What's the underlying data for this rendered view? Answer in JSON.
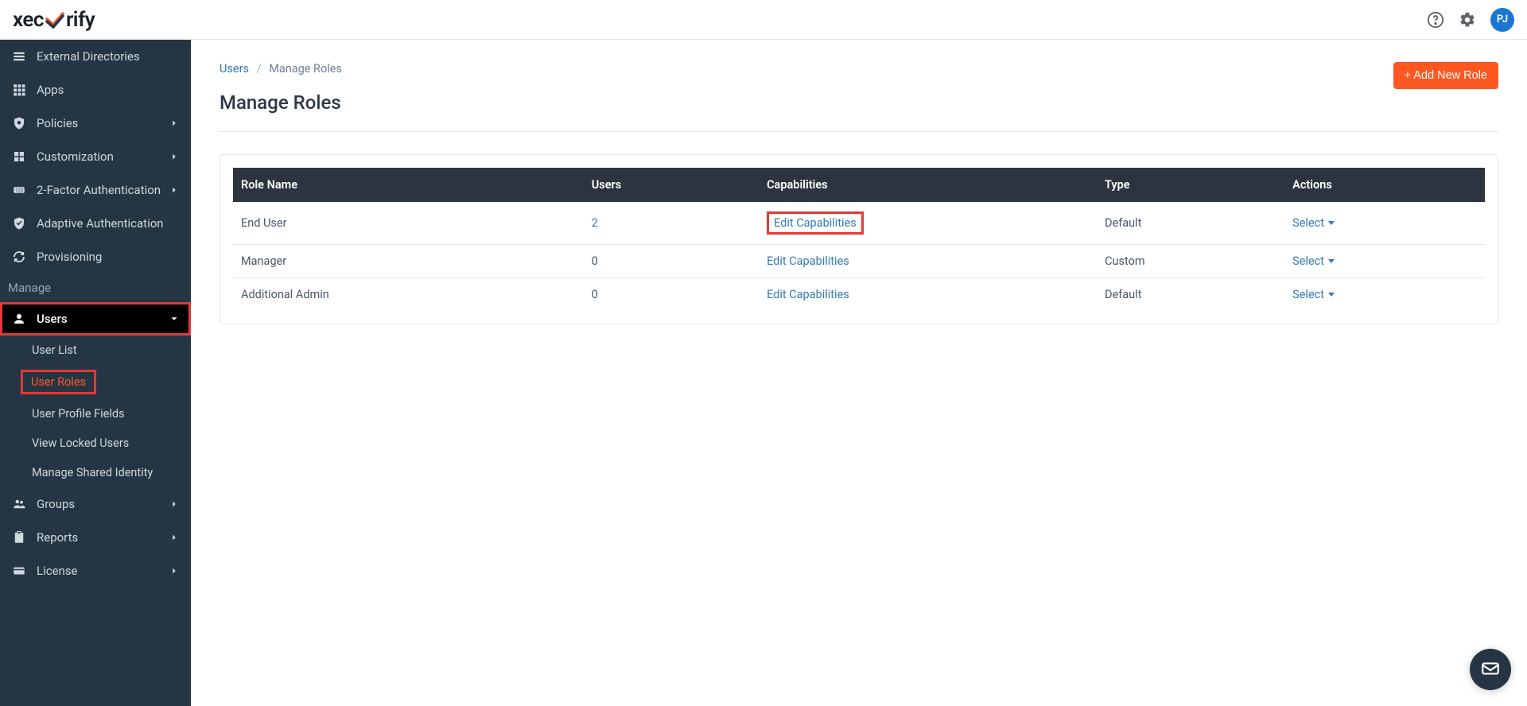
{
  "header": {
    "logo_prefix": "xec",
    "logo_suffix": "rify",
    "avatar_initials": "PJ"
  },
  "sidebar": {
    "items": [
      {
        "label": "External Directories",
        "icon": "list"
      },
      {
        "label": "Apps",
        "icon": "grid"
      },
      {
        "label": "Policies",
        "icon": "shield-search",
        "chevron": true
      },
      {
        "label": "Customization",
        "icon": "puzzle",
        "chevron": true
      },
      {
        "label": "2-Factor Authentication",
        "icon": "badge",
        "chevron": true
      },
      {
        "label": "Adaptive Authentication",
        "icon": "shield-check"
      },
      {
        "label": "Provisioning",
        "icon": "sync"
      }
    ],
    "manage_label": "Manage",
    "users": {
      "label": "Users",
      "submenu": [
        {
          "label": "User List"
        },
        {
          "label": "User Roles",
          "active": true
        },
        {
          "label": "User Profile Fields"
        },
        {
          "label": "View Locked Users"
        },
        {
          "label": "Manage Shared Identity"
        }
      ]
    },
    "tail": [
      {
        "label": "Groups",
        "icon": "groups",
        "chevron": true
      },
      {
        "label": "Reports",
        "icon": "clipboard",
        "chevron": true
      },
      {
        "label": "License",
        "icon": "card",
        "chevron": true
      }
    ]
  },
  "breadcrumb": {
    "root": "Users",
    "current": "Manage Roles"
  },
  "page_title": "Manage Roles",
  "add_button": "+ Add New Role",
  "table": {
    "headers": [
      "Role Name",
      "Users",
      "Capabilities",
      "Type",
      "Actions"
    ],
    "edit_label": "Edit Capabilities",
    "select_label": "Select",
    "rows": [
      {
        "name": "End User",
        "users": "2",
        "users_link": true,
        "type": "Default",
        "highlight": true
      },
      {
        "name": "Manager",
        "users": "0",
        "type": "Custom"
      },
      {
        "name": "Additional Admin",
        "users": "0",
        "type": "Default"
      }
    ]
  }
}
